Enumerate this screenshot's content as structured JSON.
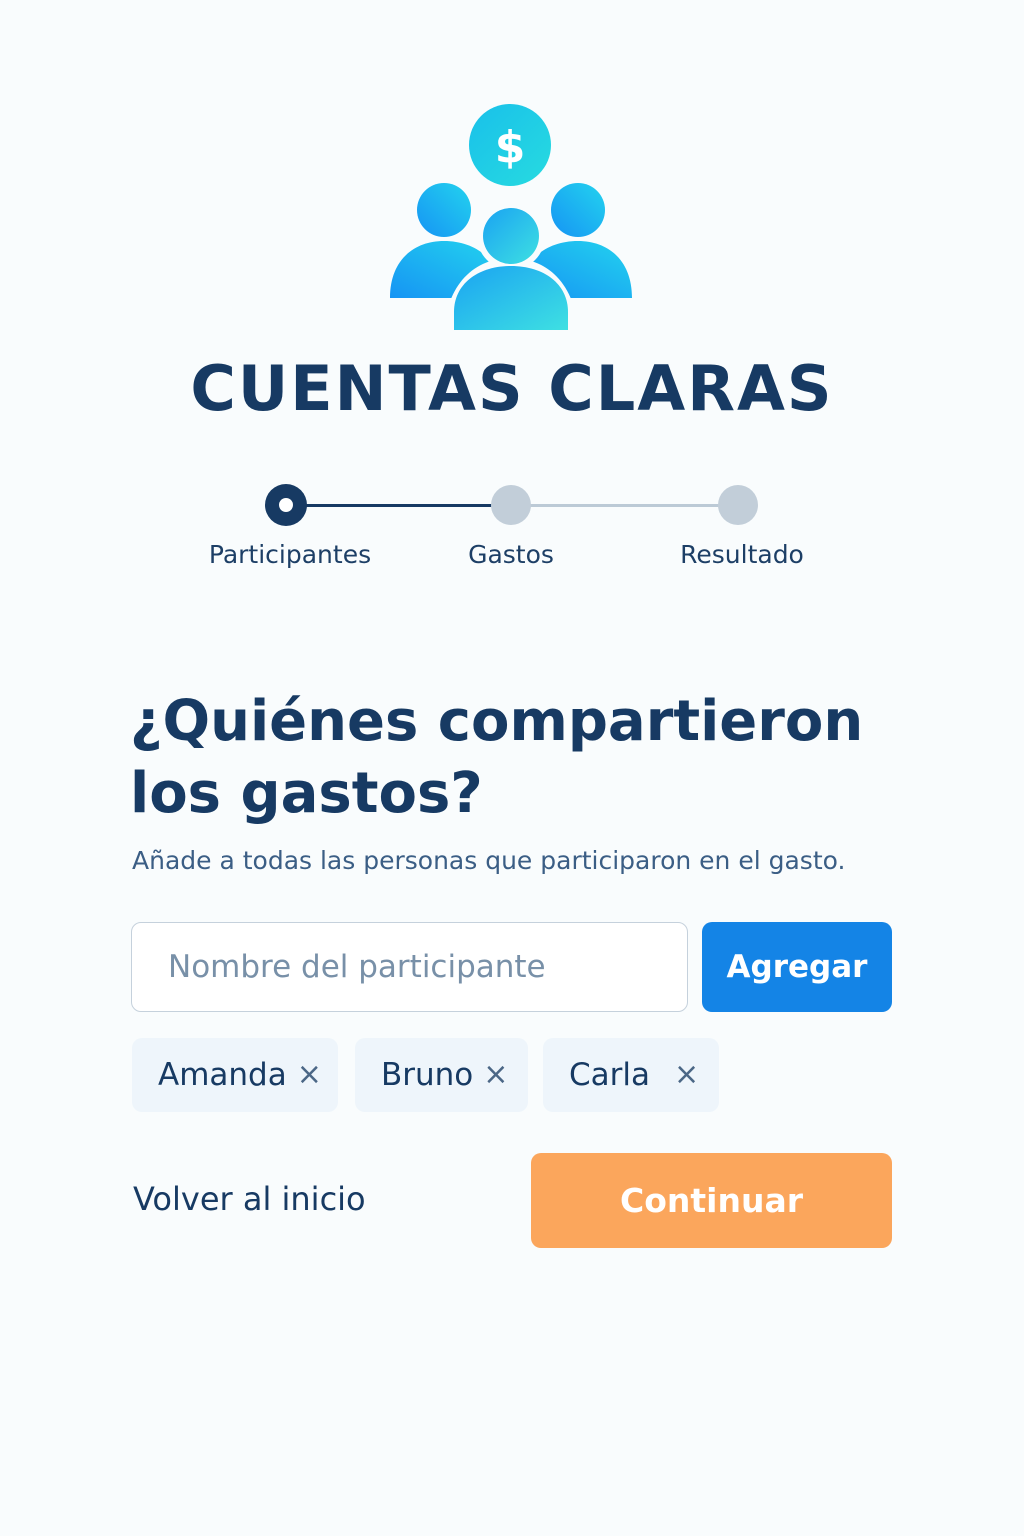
{
  "app": {
    "title": "CUENTAS CLARAS",
    "logo_icon": "group-money-icon"
  },
  "stepper": {
    "steps": [
      {
        "label": "Participantes",
        "state": "active"
      },
      {
        "label": "Gastos",
        "state": "pending"
      },
      {
        "label": "Resultado",
        "state": "pending"
      }
    ]
  },
  "main": {
    "heading_line1": "¿Quiénes compartieron",
    "heading_line2": "los gastos?",
    "subtitle": "Añade a todas las personas que participaron en el gasto.",
    "input_placeholder": "Nombre del participante",
    "input_value": "",
    "add_label": "Agregar",
    "participants": [
      {
        "name": "Amanda",
        "remove_glyph": "×"
      },
      {
        "name": "Bruno",
        "remove_glyph": "×"
      },
      {
        "name": "Carla",
        "remove_glyph": "×"
      }
    ],
    "back_label": "Volver al inicio",
    "continue_label": "Continuar"
  },
  "colors": {
    "brand_navy": "#173a63",
    "primary_blue": "#1484e6",
    "accent_orange": "#fba65c",
    "step_inactive": "#c2ced9"
  }
}
